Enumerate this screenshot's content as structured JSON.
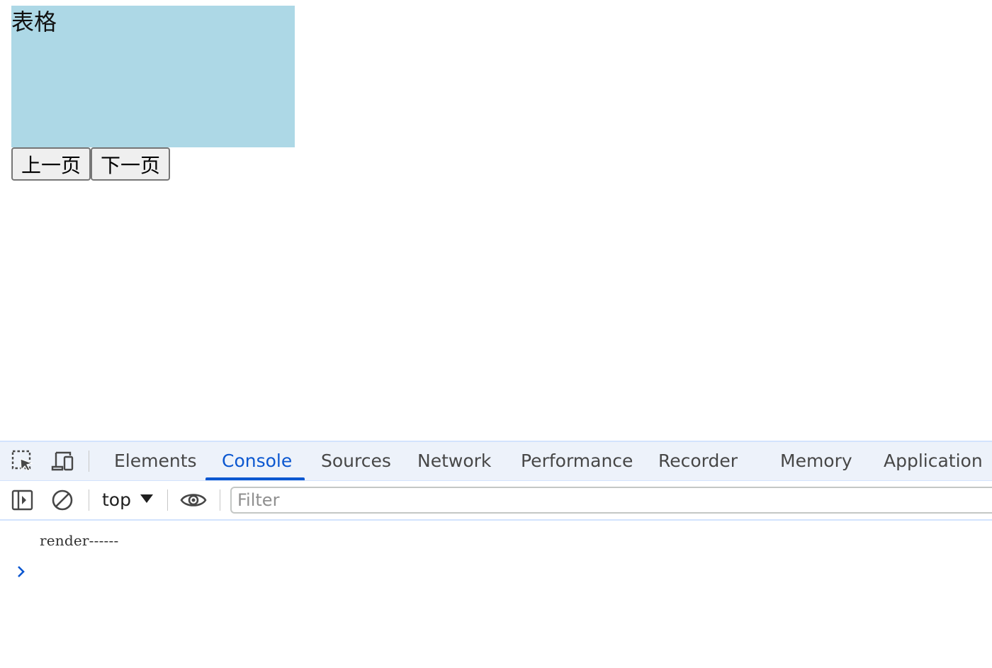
{
  "page": {
    "table_label": "表格",
    "prev_button": "上一页",
    "next_button": "下一页"
  },
  "devtools": {
    "toolbar_icons": [
      "inspect-element-icon",
      "device-toolbar-icon"
    ],
    "tabs": [
      {
        "label": "Elements",
        "active": false
      },
      {
        "label": "Console",
        "active": true
      },
      {
        "label": "Sources",
        "active": false
      },
      {
        "label": "Network",
        "active": false
      },
      {
        "label": "Performance",
        "active": false
      },
      {
        "label": "Recorder",
        "active": false
      },
      {
        "label": "Memory",
        "active": false
      },
      {
        "label": "Application",
        "active": false
      }
    ],
    "console_toolbar": {
      "icons": [
        "sidebar-toggle-icon",
        "clear-console-icon",
        "eye-icon"
      ],
      "context": "top",
      "filter_placeholder": "Filter",
      "filter_value": ""
    },
    "console": {
      "messages": [
        "render------"
      ]
    }
  },
  "colors": {
    "table_bg": "#add8e6",
    "accent": "#0b57d0",
    "tabbar_bg": "#edf2fa"
  }
}
